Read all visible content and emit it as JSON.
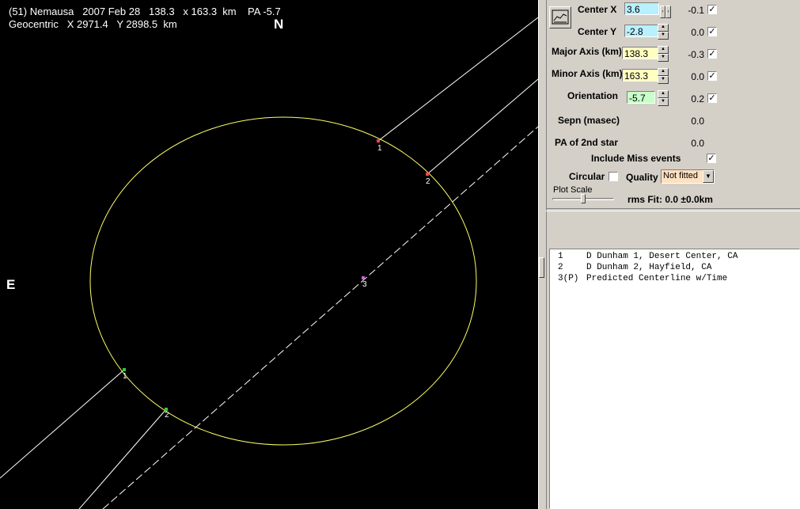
{
  "plot": {
    "header_line1": "(51) Nemausa   2007 Feb 28   138.3   x 163.3  km    PA -5.7",
    "header_line2": "Geocentric   X 2971.4   Y 2898.5  km",
    "north_label": "N",
    "east_label": "E",
    "ellipse_color": "#ffff66",
    "chord_color": "#ffffff",
    "chord_labels": {
      "upper_1": "1",
      "upper_2": "2",
      "lower_1": "1",
      "lower_2": "2",
      "center_3": "3"
    },
    "marker_colors": {
      "disappear": "#ff4444",
      "reappear": "#33cc33",
      "predicted": "#cc66cc"
    }
  },
  "controls": {
    "center_x": {
      "label": "Center X",
      "value": "3.6",
      "delta": "-0.1",
      "checked": true,
      "color": "#b8f0ff"
    },
    "center_y": {
      "label": "Center Y",
      "value": "-2.8",
      "delta": "0.0",
      "checked": true,
      "color": "#b8f0ff"
    },
    "major_axis": {
      "label": "Major Axis (km)",
      "value": "138.3",
      "delta": "-0.3",
      "checked": true,
      "color": "#ffffc0"
    },
    "minor_axis": {
      "label": "Minor Axis (km)",
      "value": "163.3",
      "delta": "0.0",
      "checked": true,
      "color": "#ffffc0"
    },
    "orientation": {
      "label": "Orientation",
      "value": "-5.7",
      "delta": "0.2",
      "checked": true,
      "color": "#c8ffc8"
    },
    "sepn": {
      "label": "Sepn (masec)",
      "value": "0.0"
    },
    "pa_2nd": {
      "label": "PA of 2nd star",
      "value": "0.0"
    },
    "include_miss": {
      "label": "Include Miss events",
      "checked": true
    },
    "circular": {
      "label": "Circular",
      "checked": false
    },
    "quality": {
      "label": "Quality",
      "value": "Not fitted",
      "color": "#ffe0c0"
    },
    "plot_scale": {
      "label": "Plot Scale",
      "level": 0.45
    },
    "rms_fit": "rms Fit: 0.0 ±0.0km"
  },
  "observers": [
    {
      "num": "1",
      "text": "D Dunham 1, Desert Center, CA"
    },
    {
      "num": "2",
      "text": "D Dunham 2, Hayfield, CA"
    },
    {
      "num": "3(P)",
      "text": "Predicted Centerline w/Time"
    }
  ]
}
